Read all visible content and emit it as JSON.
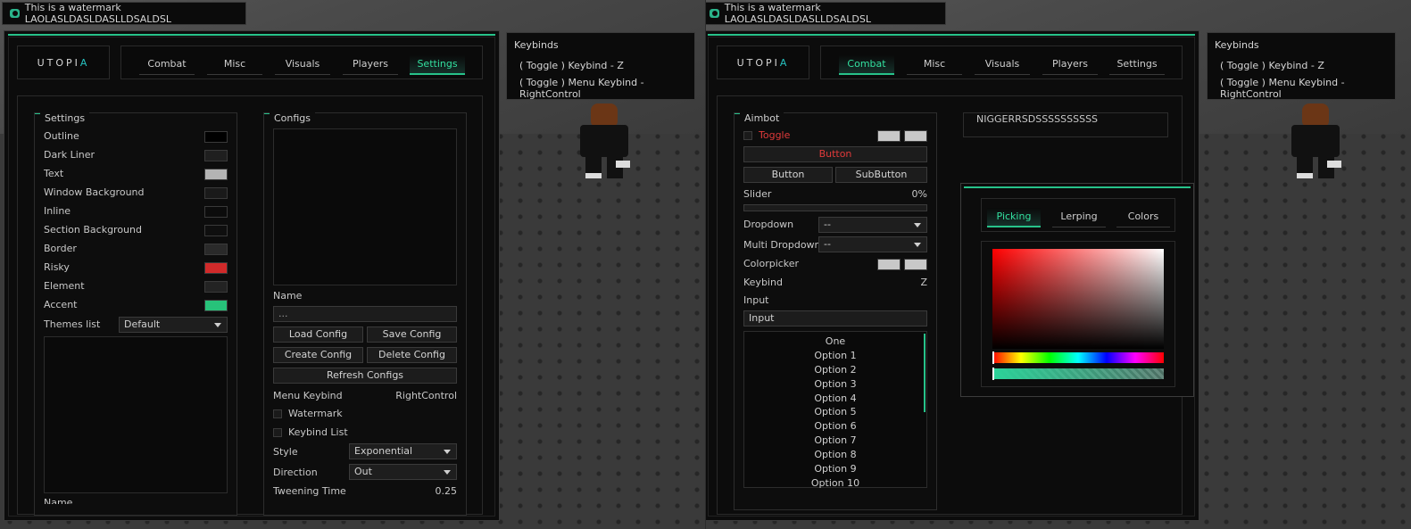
{
  "watermark": {
    "text": "This is a watermark LAOLASLDASLDASLLDSALDSL"
  },
  "logo": {
    "prefix": "UTOPI",
    "accent": "A"
  },
  "tabs": [
    "Combat",
    "Misc",
    "Visuals",
    "Players",
    "Settings"
  ],
  "keybinds": {
    "title": "Keybinds",
    "lines": [
      "( Toggle ) Keybind - Z",
      "( Toggle ) Menu Keybind - RightControl"
    ]
  },
  "left_panel": {
    "active_tab": "Settings",
    "settings": {
      "title": "Settings",
      "items": [
        {
          "label": "Outline",
          "color": "#000000"
        },
        {
          "label": "Dark Liner",
          "color": "#1f1f1f"
        },
        {
          "label": "Text",
          "color": "#b4b4b4"
        },
        {
          "label": "Window Background",
          "color": "#1a1a1a"
        },
        {
          "label": "Inline",
          "color": "#0c0c0c"
        },
        {
          "label": "Section Background",
          "color": "#0f0f0f"
        },
        {
          "label": "Border",
          "color": "#2a2a2a"
        },
        {
          "label": "Risky",
          "color": "#d12a2a"
        },
        {
          "label": "Element",
          "color": "#232323"
        },
        {
          "label": "Accent",
          "color": "#27c27a"
        }
      ],
      "themes_label": "Themes list",
      "themes_value": "Default",
      "bottom_cut_label": "Name"
    },
    "configs": {
      "title": "Configs",
      "name_label": "Name",
      "name_placeholder": "...",
      "load": "Load Config",
      "save": "Save Config",
      "create": "Create Config",
      "delete": "Delete Config",
      "refresh": "Refresh Configs",
      "menu_keybind_label": "Menu Keybind",
      "menu_keybind_value": "RightControl",
      "watermark_label": "Watermark",
      "keybind_list_label": "Keybind List",
      "style_label": "Style",
      "style_value": "Exponential",
      "direction_label": "Direction",
      "direction_value": "Out",
      "tween_label": "Tweening Time",
      "tween_value": "0.25"
    }
  },
  "right_panel": {
    "active_tab": "Combat",
    "aimbot": {
      "title": "Aimbot",
      "toggle_label": "Toggle",
      "risky_button": "Button",
      "button": "Button",
      "subbutton": "SubButton",
      "slider_label": "Slider",
      "slider_value": "0%",
      "slider_fraction": 0,
      "dropdown_label": "Dropdown",
      "dropdown_value": "--",
      "multi_label": "Multi Dropdown",
      "multi_value": "--",
      "colorpicker_label": "Colorpicker",
      "keybind_label": "Keybind",
      "keybind_value": "Z",
      "input_label": "Input",
      "input_value": "Input",
      "list": [
        "One",
        "Option 1",
        "Option 2",
        "Option 3",
        "Option 4",
        "Option 5",
        "Option 6",
        "Option 7",
        "Option 8",
        "Option 9",
        "Option 10"
      ]
    },
    "second_section_title": "NIGGERRSDSSSSSSSSSS",
    "colorpicker": {
      "tabs": [
        "Picking",
        "Lerping",
        "Colors"
      ],
      "active": "Picking",
      "hue_color": "#ff0000",
      "alpha_color": "#2bd49a"
    }
  },
  "colors": {
    "accent": "#27c28a",
    "risky": "#e03a3a",
    "background": "#0c0c0c"
  }
}
